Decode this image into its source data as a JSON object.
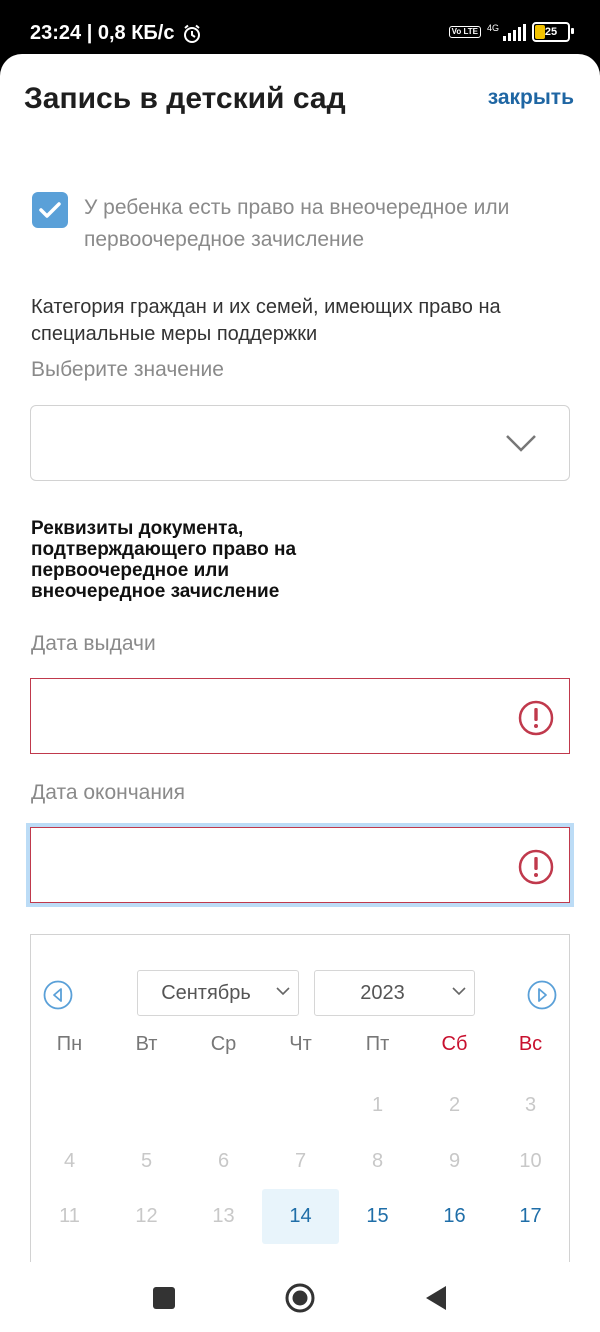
{
  "status_bar": {
    "time_speed": "23:24 | 0,8 КБ/с",
    "volte": "Vo LTE",
    "network": "4G",
    "battery": "25"
  },
  "header": {
    "title": "Запись в детский сад",
    "close_label": "закрыть"
  },
  "form": {
    "priority_checkbox": {
      "checked": true,
      "label": "У ребенка есть право на внеочередное или первоочередное зачисление"
    },
    "category": {
      "label": "Категория граждан и их семей, имеющих право на специальные меры поддержки",
      "hint": "Выберите значение",
      "value": ""
    },
    "document_title": "Реквизиты документа, подтверждающего право на первоочередное или внеочередное зачисление",
    "issue_date": {
      "label": "Дата выдачи",
      "value": "",
      "error": true
    },
    "end_date": {
      "label": "Дата окончания",
      "value": "",
      "error": true,
      "focused": true
    }
  },
  "calendar": {
    "month": "Сентябрь",
    "year": "2023",
    "weekdays": [
      "Пн",
      "Вт",
      "Ср",
      "Чт",
      "Пт",
      "Сб",
      "Вс"
    ],
    "weekend_color": "#c8102e",
    "accent_color": "#1f6ea8",
    "today": "14",
    "rows": [
      [
        "",
        "",
        "",
        "",
        "1",
        "2",
        "3"
      ],
      [
        "4",
        "5",
        "6",
        "7",
        "8",
        "9",
        "10"
      ],
      [
        "11",
        "12",
        "13",
        "14",
        "15",
        "16",
        "17"
      ]
    ],
    "first_selectable": "14"
  },
  "nav_bar": {
    "icons": [
      "recents-icon",
      "home-icon",
      "back-icon"
    ]
  }
}
